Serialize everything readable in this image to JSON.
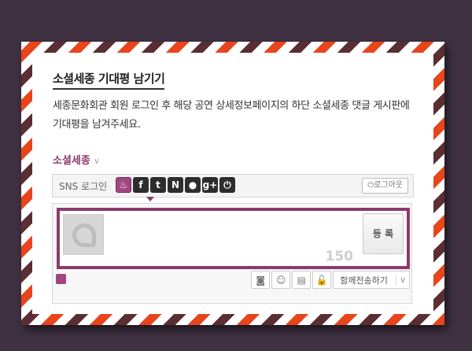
{
  "header": {
    "title": "소셜세종 기대평 남기기",
    "description": "세종문화회관 회원 로그인 후 해당 공연 상세정보페이지의 하단 소셜세종 댓글 게시판에 기대평을 남겨주세요."
  },
  "social": {
    "section_label": "소셜세종",
    "chevron": "∨",
    "sns_label": "SNS 로그인",
    "icons": [
      {
        "name": "sejong-icon",
        "glyph": "♨"
      },
      {
        "name": "facebook-icon",
        "glyph": "f"
      },
      {
        "name": "twitter-icon",
        "glyph": "t"
      },
      {
        "name": "naver-icon",
        "glyph": "N"
      },
      {
        "name": "me2day-icon",
        "glyph": "●"
      },
      {
        "name": "googleplus-icon",
        "glyph": "g+"
      },
      {
        "name": "power-icon",
        "glyph": "⏻"
      }
    ],
    "logout_label": "⏻로그아웃"
  },
  "comment": {
    "char_count": "150",
    "submit_label": "등 록"
  },
  "toolbar": {
    "tools": [
      {
        "name": "camera-icon",
        "glyph": "◙"
      },
      {
        "name": "emoticon-icon",
        "glyph": "☺"
      },
      {
        "name": "document-icon",
        "glyph": "▤"
      },
      {
        "name": "lock-icon",
        "glyph": "🔓"
      }
    ],
    "share_label": "함께전송하기",
    "share_caret": "∨"
  },
  "colors": {
    "accent": "#8b3a6e",
    "stripe_red": "#e8451c",
    "stripe_brown": "#5a2e33",
    "background": "#3f3142"
  }
}
